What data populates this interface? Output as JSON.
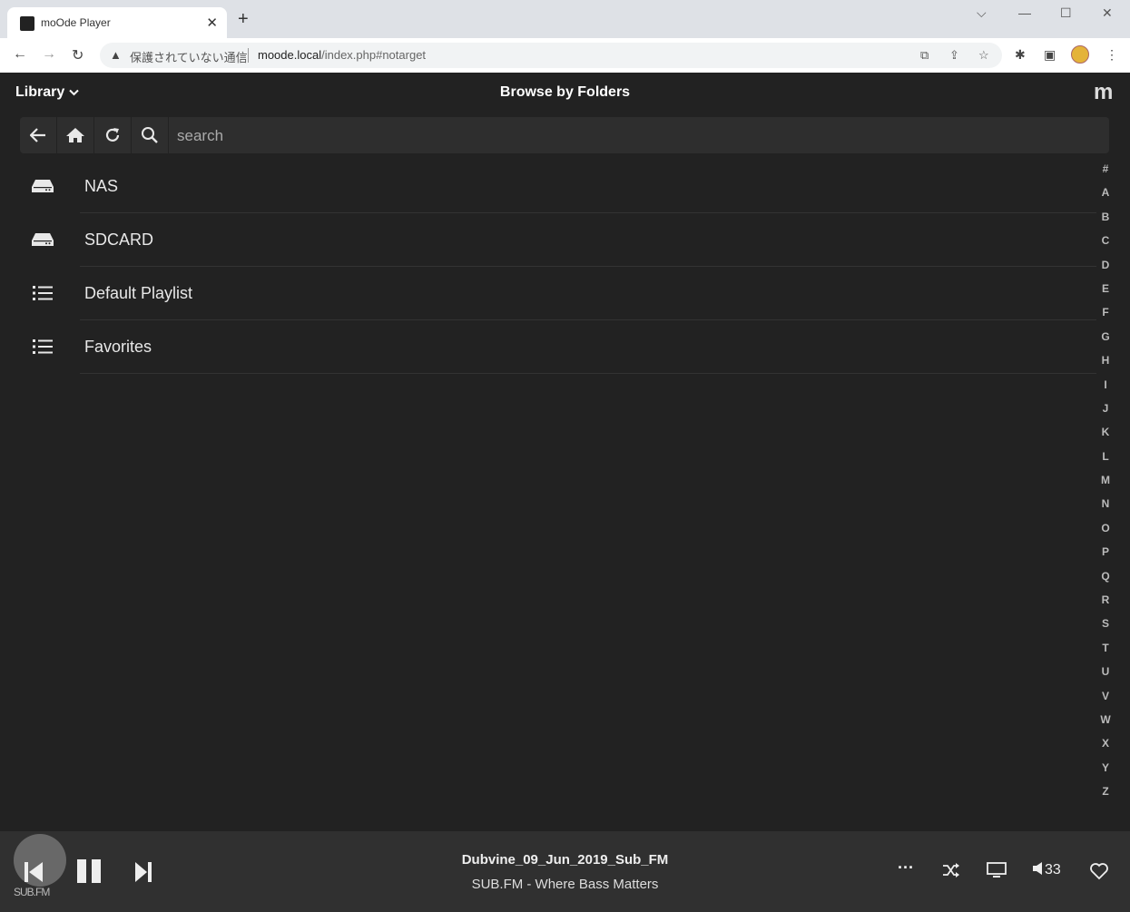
{
  "browser": {
    "tab_title": "moOde Player",
    "new_tab_label": "+",
    "security_text": "保護されていない通信",
    "url_host": "moode.local",
    "url_path": "/index.php#notarget"
  },
  "header": {
    "library_label": "Library",
    "title": "Browse by Folders",
    "logo": "m"
  },
  "search": {
    "placeholder": "search"
  },
  "folders": [
    {
      "label": "NAS",
      "icon": "drive-icon"
    },
    {
      "label": "SDCARD",
      "icon": "drive-icon"
    },
    {
      "label": "Default Playlist",
      "icon": "list-icon"
    },
    {
      "label": "Favorites",
      "icon": "list-icon"
    }
  ],
  "alphabet": [
    "#",
    "A",
    "B",
    "C",
    "D",
    "E",
    "F",
    "G",
    "H",
    "I",
    "J",
    "K",
    "L",
    "M",
    "N",
    "O",
    "P",
    "Q",
    "R",
    "S",
    "T",
    "U",
    "V",
    "W",
    "X",
    "Y",
    "Z"
  ],
  "player": {
    "cover_text": "SUB.FM",
    "track": "Dubvine_09_Jun_2019_Sub_FM",
    "station": "SUB.FM - Where Bass Matters",
    "volume": "33"
  },
  "colors": {
    "background": "#222222",
    "playbar": "#303030",
    "text": "#e8e8e8"
  }
}
